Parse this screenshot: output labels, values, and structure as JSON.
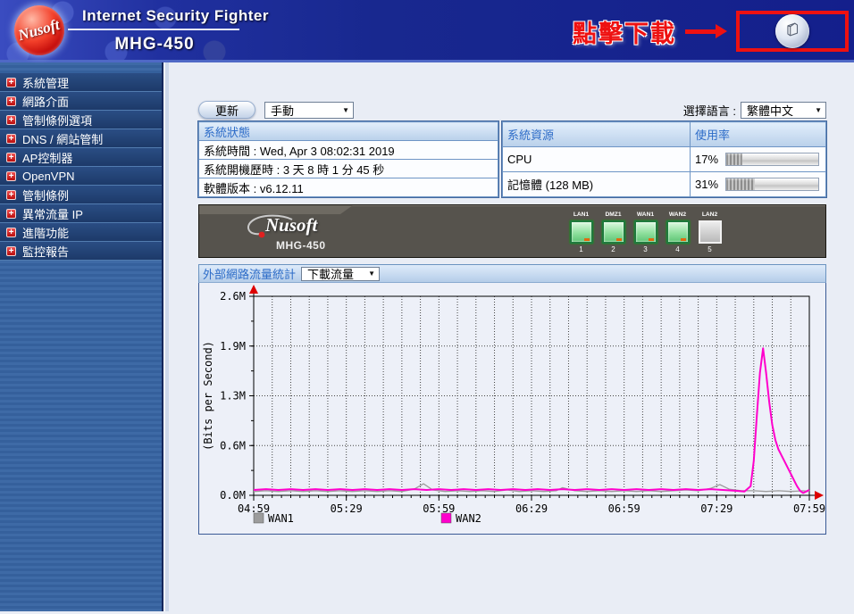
{
  "header": {
    "logo_text": "Nusoft",
    "product": "Internet Security Fighter",
    "model": "MHG-450",
    "download_hint": "點擊下載"
  },
  "sidebar": {
    "items": [
      {
        "label": "系統管理"
      },
      {
        "label": "網路介面"
      },
      {
        "label": "管制條例選項"
      },
      {
        "label": "DNS / 網站管制"
      },
      {
        "label": "AP控制器"
      },
      {
        "label": "OpenVPN"
      },
      {
        "label": "管制條例"
      },
      {
        "label": "異常流量 IP"
      },
      {
        "label": "進階功能"
      },
      {
        "label": "監控報告"
      }
    ]
  },
  "controls": {
    "refresh_button": "更新",
    "refresh_mode": "手動",
    "language_label": "選擇語言 :",
    "language_value": "繁體中文"
  },
  "status_table": {
    "header": "系統狀態",
    "rows": [
      "系統時間 : Wed, Apr 3 08:02:31 2019",
      "系統開機歷時 : 3 天 8 時 1 分 45 秒",
      "軟體版本 : v6.12.11"
    ]
  },
  "resource_table": {
    "header_resource": "系統資源",
    "header_usage": "使用率",
    "rows": [
      {
        "name": "CPU",
        "percent": "17%",
        "value": 17
      },
      {
        "name": "記憶體 (128 MB)",
        "percent": "31%",
        "value": 31
      }
    ]
  },
  "device": {
    "brand": "Nusoft",
    "model": "MHG-450",
    "ports": [
      {
        "label": "LAN1",
        "number": "1",
        "state": "active"
      },
      {
        "label": "DMZ1",
        "number": "2",
        "state": "active"
      },
      {
        "label": "WAN1",
        "number": "3",
        "state": "active"
      },
      {
        "label": "WAN2",
        "number": "4",
        "state": "active"
      },
      {
        "label": "LAN2",
        "number": "5",
        "state": "inactive"
      }
    ]
  },
  "traffic_section": {
    "title": "外部網路流量統計",
    "mode_select": "下載流量"
  },
  "chart_data": {
    "type": "line",
    "title": "外部網路流量統計 (下載流量)",
    "xlabel": "",
    "ylabel": "(Bits per Second)",
    "x_range_minutes": [
      0,
      180
    ],
    "ylim": [
      0,
      2.6
    ],
    "grid": true,
    "axis_arrow_color": "#dd0000",
    "x_ticks": [
      {
        "label": "04:59",
        "minute": 0
      },
      {
        "label": "05:29",
        "minute": 30
      },
      {
        "label": "05:59",
        "minute": 60
      },
      {
        "label": "06:29",
        "minute": 90
      },
      {
        "label": "06:59",
        "minute": 120
      },
      {
        "label": "07:29",
        "minute": 150
      },
      {
        "label": "07:59",
        "minute": 180
      }
    ],
    "y_ticks": [
      {
        "label": "0.0M",
        "value": 0
      },
      {
        "label": "0.6M",
        "value": 0.65
      },
      {
        "label": "1.3M",
        "value": 1.3
      },
      {
        "label": "1.9M",
        "value": 1.95
      },
      {
        "label": "2.6M",
        "value": 2.6
      }
    ],
    "legend_position": "bottom",
    "legend": [
      {
        "label": "WAN1",
        "color": "#9c9c9c"
      },
      {
        "label": "WAN2",
        "color": "#ff00cc"
      }
    ],
    "series": [
      {
        "name": "WAN1",
        "color": "#9c9c9c",
        "width": 1.3,
        "points": [
          [
            0,
            0.05
          ],
          [
            4,
            0.06
          ],
          [
            8,
            0.05
          ],
          [
            12,
            0.06
          ],
          [
            16,
            0.05
          ],
          [
            20,
            0.06
          ],
          [
            24,
            0.05
          ],
          [
            28,
            0.06
          ],
          [
            32,
            0.05
          ],
          [
            36,
            0.06
          ],
          [
            40,
            0.05
          ],
          [
            44,
            0.06
          ],
          [
            48,
            0.05
          ],
          [
            52,
            0.08
          ],
          [
            55,
            0.15
          ],
          [
            58,
            0.07
          ],
          [
            62,
            0.05
          ],
          [
            66,
            0.06
          ],
          [
            70,
            0.05
          ],
          [
            74,
            0.06
          ],
          [
            78,
            0.05
          ],
          [
            82,
            0.07
          ],
          [
            86,
            0.05
          ],
          [
            90,
            0.06
          ],
          [
            94,
            0.05
          ],
          [
            98,
            0.06
          ],
          [
            100,
            0.1
          ],
          [
            104,
            0.06
          ],
          [
            108,
            0.05
          ],
          [
            112,
            0.06
          ],
          [
            116,
            0.05
          ],
          [
            120,
            0.06
          ],
          [
            124,
            0.05
          ],
          [
            128,
            0.06
          ],
          [
            132,
            0.05
          ],
          [
            136,
            0.06
          ],
          [
            140,
            0.07
          ],
          [
            144,
            0.06
          ],
          [
            148,
            0.09
          ],
          [
            151,
            0.14
          ],
          [
            154,
            0.08
          ],
          [
            158,
            0.06
          ],
          [
            162,
            0.06
          ],
          [
            166,
            0.05
          ],
          [
            170,
            0.06
          ],
          [
            174,
            0.05
          ],
          [
            178,
            0.06
          ],
          [
            180,
            0.05
          ]
        ]
      },
      {
        "name": "WAN2",
        "color": "#ff00cc",
        "width": 2,
        "points": [
          [
            0,
            0.07
          ],
          [
            4,
            0.08
          ],
          [
            8,
            0.07
          ],
          [
            12,
            0.08
          ],
          [
            16,
            0.07
          ],
          [
            20,
            0.08
          ],
          [
            24,
            0.07
          ],
          [
            28,
            0.08
          ],
          [
            32,
            0.07
          ],
          [
            36,
            0.08
          ],
          [
            40,
            0.07
          ],
          [
            44,
            0.08
          ],
          [
            48,
            0.07
          ],
          [
            52,
            0.08
          ],
          [
            56,
            0.07
          ],
          [
            60,
            0.08
          ],
          [
            64,
            0.07
          ],
          [
            68,
            0.08
          ],
          [
            72,
            0.07
          ],
          [
            76,
            0.08
          ],
          [
            80,
            0.07
          ],
          [
            84,
            0.08
          ],
          [
            88,
            0.07
          ],
          [
            92,
            0.08
          ],
          [
            96,
            0.07
          ],
          [
            100,
            0.08
          ],
          [
            104,
            0.07
          ],
          [
            108,
            0.08
          ],
          [
            112,
            0.07
          ],
          [
            116,
            0.08
          ],
          [
            120,
            0.07
          ],
          [
            124,
            0.08
          ],
          [
            128,
            0.07
          ],
          [
            132,
            0.08
          ],
          [
            136,
            0.07
          ],
          [
            140,
            0.08
          ],
          [
            144,
            0.07
          ],
          [
            148,
            0.08
          ],
          [
            152,
            0.07
          ],
          [
            156,
            0.06
          ],
          [
            159,
            0.05
          ],
          [
            161,
            0.12
          ],
          [
            162,
            0.45
          ],
          [
            163,
            1.05
          ],
          [
            164,
            1.6
          ],
          [
            165,
            1.92
          ],
          [
            166,
            1.6
          ],
          [
            167,
            1.22
          ],
          [
            168,
            0.92
          ],
          [
            169,
            0.72
          ],
          [
            170,
            0.6
          ],
          [
            171,
            0.52
          ],
          [
            172,
            0.44
          ],
          [
            173,
            0.36
          ],
          [
            174,
            0.28
          ],
          [
            175,
            0.2
          ],
          [
            176,
            0.12
          ],
          [
            177,
            0.06
          ],
          [
            178,
            0.03
          ],
          [
            179,
            0.05
          ],
          [
            180,
            0.07
          ]
        ]
      }
    ]
  }
}
